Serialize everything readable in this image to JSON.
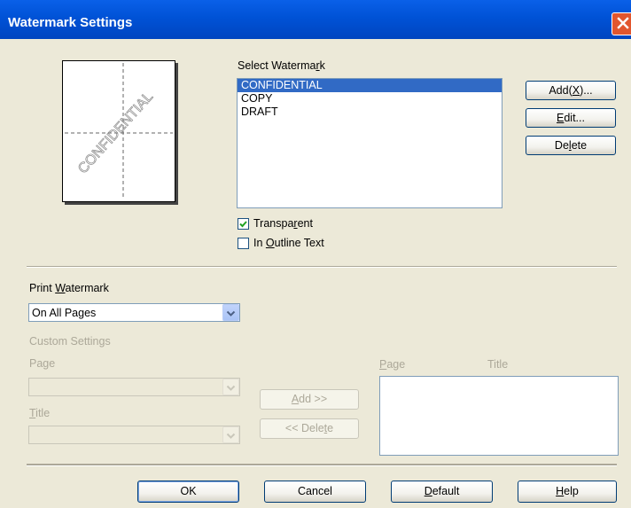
{
  "window": {
    "title": "Watermark Settings"
  },
  "preview": {
    "watermark_text": "CONFIDENTIAL"
  },
  "select_watermark": {
    "label_pre": "Select Waterma",
    "label_key": "r",
    "label_post": "k",
    "items": [
      "CONFIDENTIAL",
      "COPY",
      "DRAFT"
    ],
    "selected": "CONFIDENTIAL"
  },
  "side_buttons": {
    "add": {
      "pre": "Add(",
      "key": "X",
      "post": ")..."
    },
    "edit": {
      "pre": "",
      "key": "E",
      "post": "dit..."
    },
    "delete": {
      "pre": "De",
      "key": "l",
      "post": "ete"
    }
  },
  "options": {
    "transparent": {
      "pre": "Transpa",
      "key": "r",
      "post": "ent",
      "checked": true
    },
    "outline": {
      "pre": "In ",
      "key": "O",
      "post": "utline Text",
      "checked": false
    }
  },
  "print_watermark": {
    "label_pre": "Print ",
    "label_key": "W",
    "label_post": "atermark",
    "value": "On All Pages"
  },
  "custom": {
    "heading": "Custom Settings",
    "page_label": "Page",
    "title_pre": "",
    "title_key": "T",
    "title_post": "itle",
    "add_pre": "",
    "add_key": "A",
    "add_post": "dd >>",
    "delete_pre": "<< Dele",
    "delete_key": "t",
    "delete_post": "e",
    "col_page_key": "P",
    "col_page_post": "age",
    "col_title": "Title"
  },
  "footer": {
    "ok": "OK",
    "cancel": "Cancel",
    "default": {
      "pre": "",
      "key": "D",
      "post": "efault"
    },
    "help": {
      "pre": "",
      "key": "H",
      "post": "elp"
    }
  }
}
